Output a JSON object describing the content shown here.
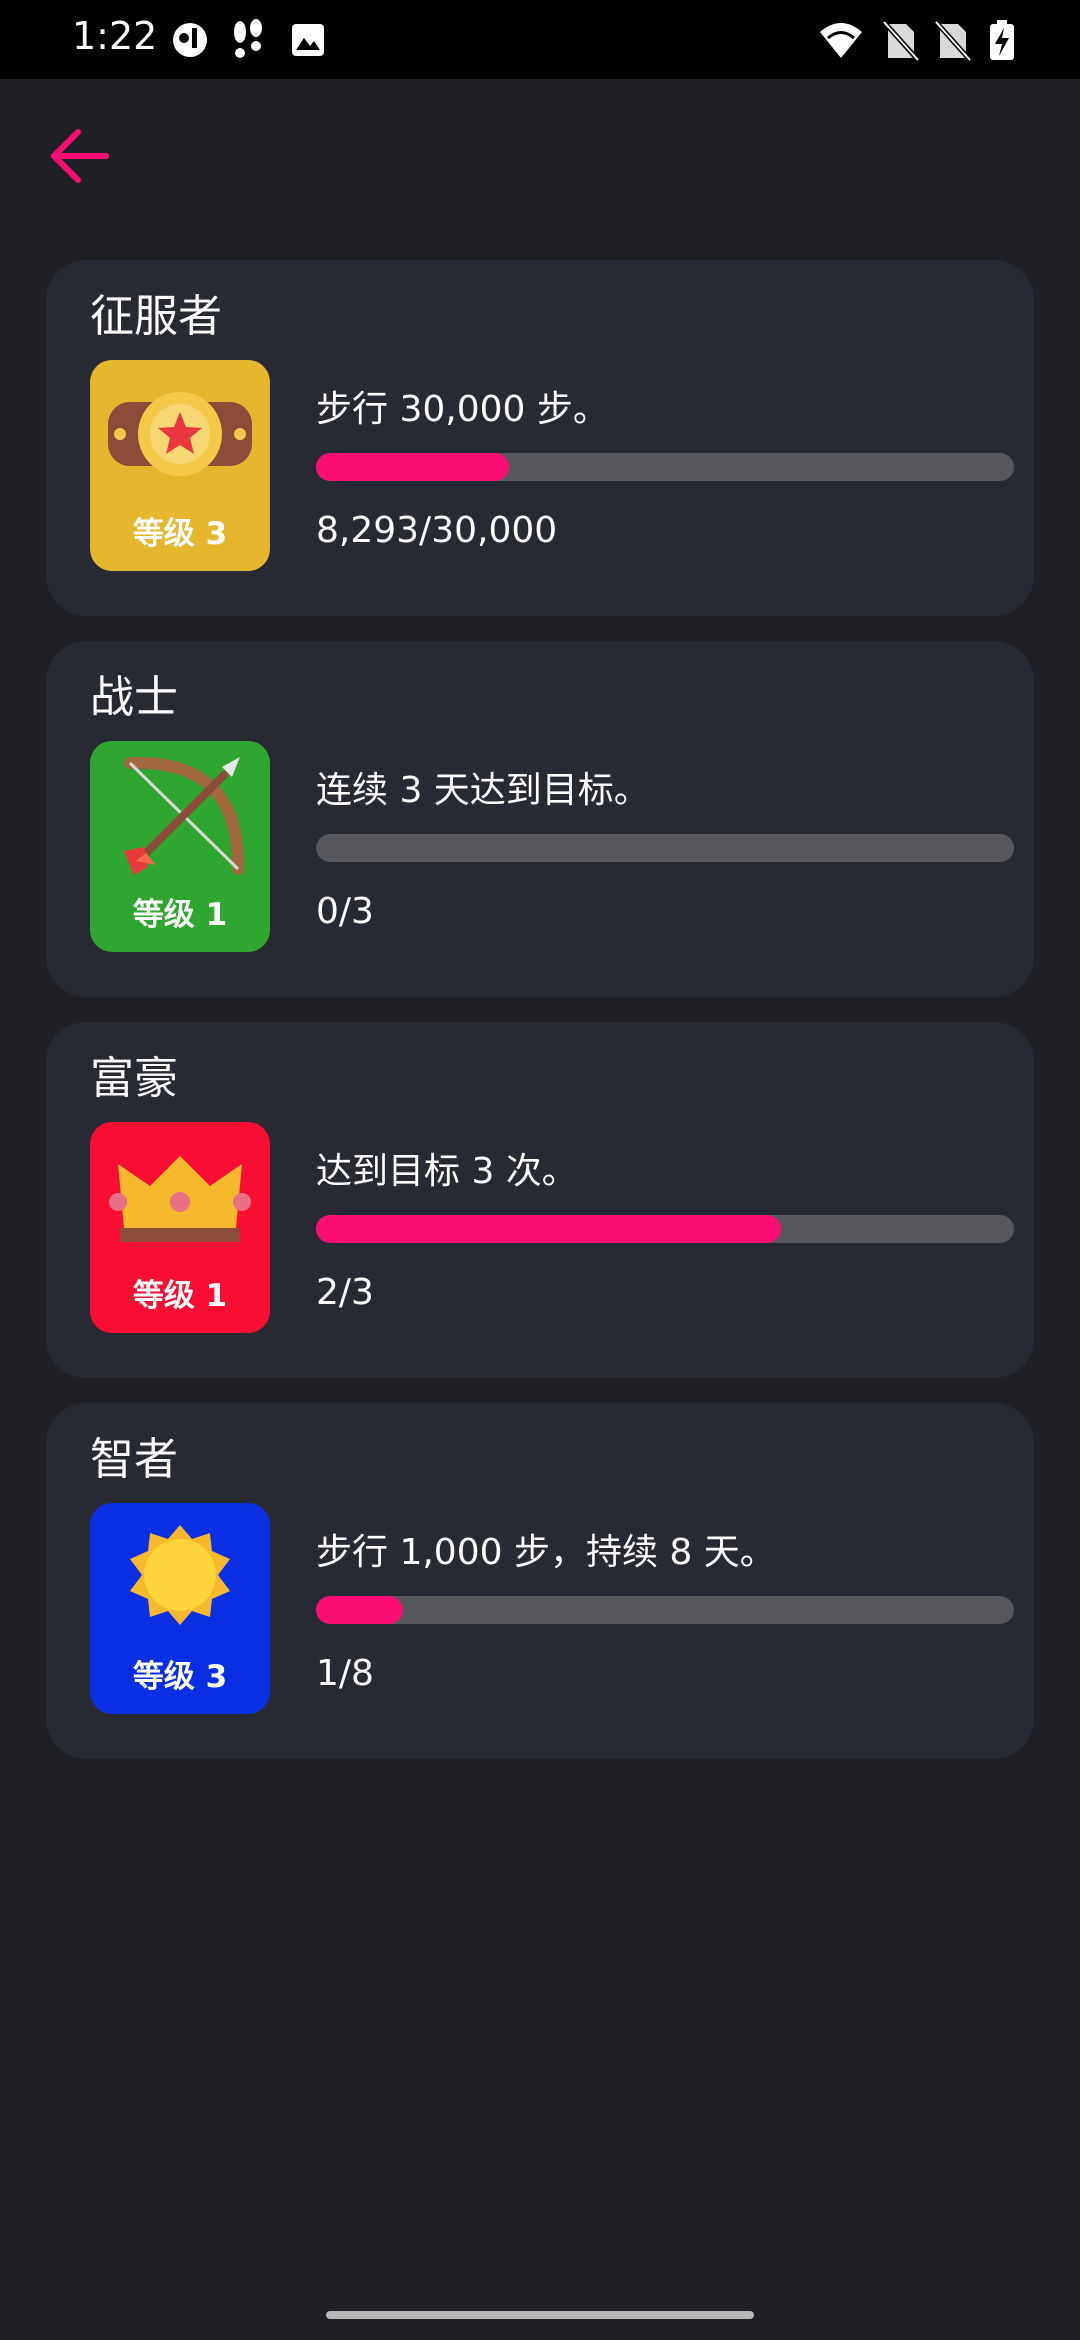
{
  "status_bar": {
    "time": "1:22",
    "icons": [
      "app-notification-icon",
      "footsteps-icon",
      "image-icon",
      "wifi-icon",
      "no-sim-icon",
      "no-sim-icon",
      "battery-charging-icon"
    ]
  },
  "header": {
    "back_icon": "arrow-left-icon",
    "accent": "#fc0d73"
  },
  "achievements": [
    {
      "title": "征服者",
      "badge_icon": "championship-belt-icon",
      "badge_color": "#e4b72f",
      "level": "等级 3",
      "description": "步行 30,000 步。",
      "progress": 0.2764,
      "count": "8,293/30,000"
    },
    {
      "title": "战士",
      "badge_icon": "bow-and-arrow-icon",
      "badge_color": "#2ea62f",
      "level": "等级 1",
      "description": "连续 3 天达到目标。",
      "progress": 0.0,
      "count": "0/3"
    },
    {
      "title": "富豪",
      "badge_icon": "crown-icon",
      "badge_color": "#f70e32",
      "level": "等级 1",
      "description": "达到目标 3 次。",
      "progress": 0.6667,
      "count": "2/3"
    },
    {
      "title": "智者",
      "badge_icon": "sun-icon",
      "badge_color": "#0a2fe3",
      "level": "等级 3",
      "description": "步行 1,000 步，持续 8 天。",
      "progress": 0.125,
      "count": "1/8"
    }
  ],
  "colors": {
    "background": "#1f2024",
    "card": "#272a32",
    "track": "#56575b",
    "progress_fill": "#fc0d73"
  }
}
